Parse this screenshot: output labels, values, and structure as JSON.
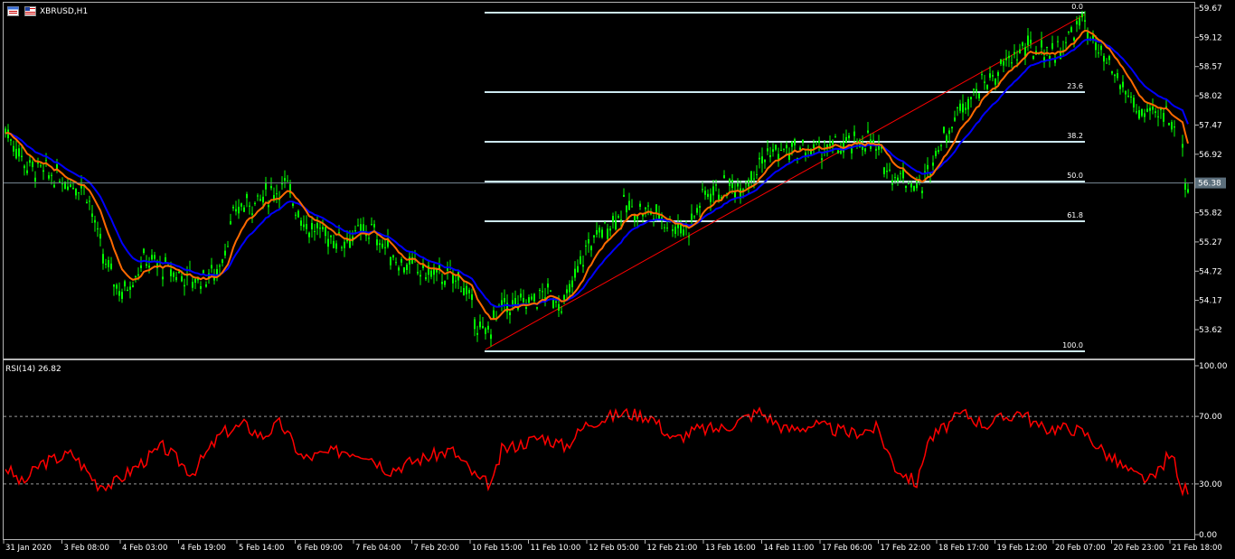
{
  "header": {
    "symbol_title": "XBRUSD,H1"
  },
  "rsi": {
    "title": "RSI(14) 26.82",
    "levels": [
      {
        "label": "100.00",
        "value": 100
      },
      {
        "label": "70.00",
        "value": 70
      },
      {
        "label": "30.00",
        "value": 30
      },
      {
        "label": "0.00",
        "value": 0
      }
    ]
  },
  "price_axis": {
    "ticks": [
      "59.67",
      "59.12",
      "58.57",
      "58.02",
      "57.47",
      "56.92",
      "56.37",
      "55.82",
      "55.27",
      "54.72",
      "54.17",
      "53.62"
    ],
    "current_price": "56.38"
  },
  "time_axis": {
    "labels": [
      "31 Jan 2020",
      "3 Feb 08:00",
      "4 Feb 03:00",
      "4 Feb 19:00",
      "5 Feb 14:00",
      "6 Feb 09:00",
      "7 Feb 04:00",
      "7 Feb 20:00",
      "10 Feb 15:00",
      "11 Feb 10:00",
      "12 Feb 05:00",
      "12 Feb 21:00",
      "13 Feb 16:00",
      "14 Feb 11:00",
      "17 Feb 06:00",
      "17 Feb 22:00",
      "18 Feb 17:00",
      "19 Feb 12:00",
      "20 Feb 07:00",
      "20 Feb 23:00",
      "21 Feb 18:00"
    ]
  },
  "fibonacci": {
    "levels": [
      {
        "label": "0.0",
        "price": 59.53
      },
      {
        "label": "23.6",
        "price": 58.03
      },
      {
        "label": "38.2",
        "price": 57.1
      },
      {
        "label": "50.0",
        "price": 56.37
      },
      {
        "label": "61.8",
        "price": 55.6
      },
      {
        "label": "100.0",
        "price": 53.25
      }
    ]
  },
  "colors": {
    "background": "#000000",
    "candle": "#00ff00",
    "ma_fast": "#ff6a00",
    "ma_slow": "#0000ff",
    "fib_lines": "#cce8f0",
    "rsi_line": "#ff0000",
    "trendline": "#ff0000"
  },
  "chart_data": {
    "type": "candlestick",
    "symbol": "XBRUSD",
    "timeframe": "H1",
    "ylim": [
      53.35,
      59.67
    ],
    "close_trace": [
      [
        "31 Jan 2020",
        57.3
      ],
      [
        "3 Feb 08:00",
        56.3
      ],
      [
        "4 Feb 03:00",
        54.9
      ],
      [
        "4 Feb 19:00",
        54.5
      ],
      [
        "5 Feb 14:00",
        55.9
      ],
      [
        "6 Feb 09:00",
        55.6
      ],
      [
        "7 Feb 04:00",
        55.3
      ],
      [
        "7 Feb 20:00",
        54.6
      ],
      [
        "10 Feb 15:00",
        53.35
      ],
      [
        "11 Feb 10:00",
        54.2
      ],
      [
        "12 Feb 05:00",
        55.2
      ],
      [
        "12 Feb 21:00",
        55.6
      ],
      [
        "13 Feb 16:00",
        56.4
      ],
      [
        "14 Feb 11:00",
        56.9
      ],
      [
        "17 Feb 06:00",
        57.2
      ],
      [
        "17 Feb 22:00",
        56.2
      ],
      [
        "18 Feb 17:00",
        57.5
      ],
      [
        "19 Feb 12:00",
        58.8
      ],
      [
        "20 Feb 07:00",
        59.1
      ],
      [
        "20 Feb 23:00",
        57.7
      ],
      [
        "21 Feb 18:00",
        57.4
      ]
    ],
    "last_price": 56.38,
    "rsi_period": 14,
    "rsi_last": 26.82
  }
}
